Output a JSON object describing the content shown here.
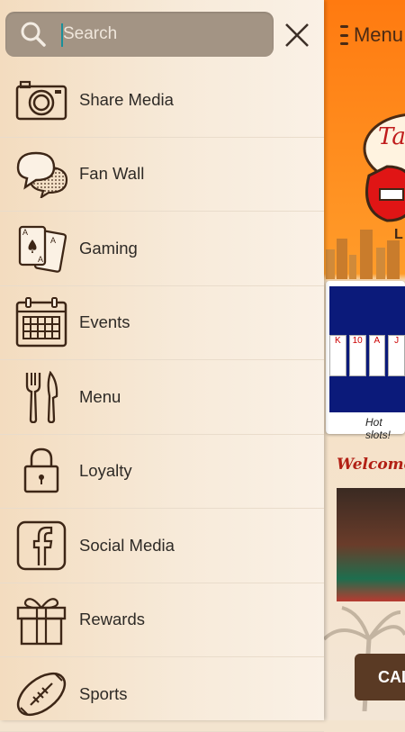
{
  "search": {
    "placeholder": "Search",
    "value": ""
  },
  "menu_items": [
    {
      "label": "Share Media",
      "icon": "camera-icon"
    },
    {
      "label": "Fan Wall",
      "icon": "chat-bubbles-icon"
    },
    {
      "label": "Gaming",
      "icon": "playing-cards-icon"
    },
    {
      "label": "Events",
      "icon": "calendar-icon"
    },
    {
      "label": "Menu",
      "icon": "fork-knife-icon"
    },
    {
      "label": "Loyalty",
      "icon": "lock-icon"
    },
    {
      "label": "Social Media",
      "icon": "facebook-icon"
    },
    {
      "label": "Rewards",
      "icon": "gift-icon"
    },
    {
      "label": "Sports",
      "icon": "football-icon"
    }
  ],
  "background_app": {
    "menu_label": "Menu",
    "slot_caption": "Hot slots!",
    "welcome_text": "Welcome",
    "call_button_label": "CAL"
  },
  "colors": {
    "icon_stroke": "#3d2616",
    "search_bg": "#a39484",
    "drawer_bg": "#f5e6d3"
  }
}
